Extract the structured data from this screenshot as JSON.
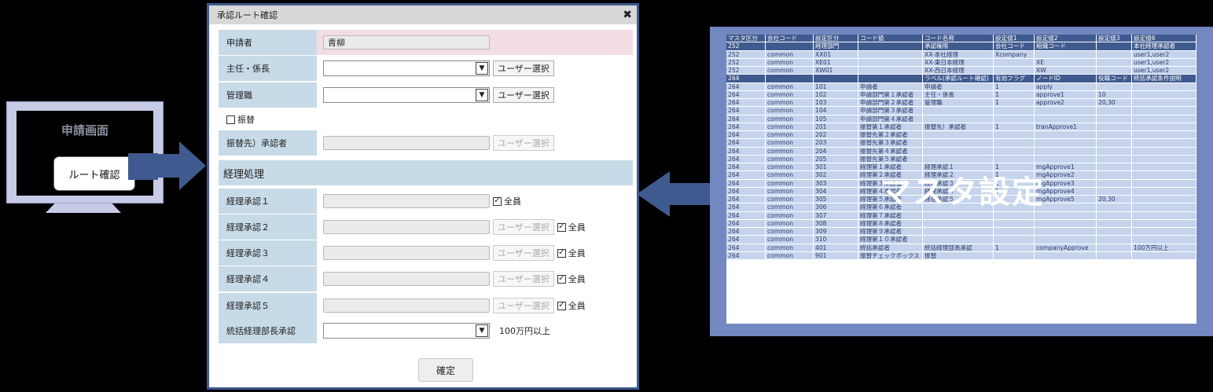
{
  "monitor": {
    "title": "申請画面",
    "button": "ルート確認"
  },
  "dialog": {
    "title": "承認ルート確認",
    "close": "✖",
    "applicant": {
      "label": "申請者",
      "value": "青柳"
    },
    "rows": [
      {
        "label": "主任・係長",
        "btn": "ユーザー選択"
      },
      {
        "label": "管理職",
        "btn": "ユーザー選択"
      }
    ],
    "transfer_checkbox": "振替",
    "transfer_approver": {
      "label": "振替先）承認者",
      "btn": "ユーザー選択"
    },
    "section": "経理処理",
    "accounting": [
      {
        "label": "経理承認１",
        "btn": "",
        "check": "全員"
      },
      {
        "label": "経理承認２",
        "btn": "ユーザー選択",
        "check": "全員"
      },
      {
        "label": "経理承認３",
        "btn": "ユーザー選択",
        "check": "全員"
      },
      {
        "label": "経理承認４",
        "btn": "ユーザー選択",
        "check": "全員"
      },
      {
        "label": "経理承認５",
        "btn": "ユーザー選択",
        "check": "全員"
      }
    ],
    "director": {
      "label": "統括経理部長承認",
      "note": "100万円以上"
    },
    "confirm": "確定"
  },
  "master": {
    "label": "マスタ設定",
    "header1": [
      "マスタ区分",
      "会社コード",
      "設定区分",
      "コード値",
      "コード名称",
      "設定値1",
      "設定値2",
      "設定値3",
      "設定値6"
    ],
    "header2": [
      "252",
      "",
      "経理部門",
      "",
      "承認権限",
      "会社コード",
      "組織コード",
      "",
      "本社経理承認者"
    ],
    "group1": [
      [
        "252",
        "common",
        "XX01",
        "",
        "XX-本社経理",
        "Xcompany",
        "",
        "",
        "user1,user2"
      ],
      [
        "252",
        "common",
        "XE01",
        "",
        "XX-東日本経理",
        "",
        "XE",
        "",
        "user1,user2"
      ],
      [
        "252",
        "common",
        "XW01",
        "",
        "XX-西日本経理",
        "",
        "XW",
        "",
        "user1,user2"
      ]
    ],
    "header3": [
      "264",
      "",
      "",
      "",
      "ラベル(承認ルート確認)",
      "有効フラグ",
      "ノードID",
      "役職コード",
      "統括承認条件説明"
    ],
    "group2": [
      [
        "264",
        "common",
        "101",
        "申請者",
        "申請者",
        "1",
        "apply",
        "",
        ""
      ],
      [
        "264",
        "common",
        "102",
        "申請部門第１承認者",
        "主任・係長",
        "1",
        "approve1",
        "10",
        ""
      ],
      [
        "264",
        "common",
        "103",
        "申請部門第２承認者",
        "管理職",
        "1",
        "approve2",
        "20,30",
        ""
      ],
      [
        "264",
        "common",
        "104",
        "申請部門第３承認者",
        "",
        "",
        "",
        "",
        ""
      ],
      [
        "264",
        "common",
        "105",
        "申請部門第４承認者",
        "",
        "",
        "",
        "",
        ""
      ],
      [
        "264",
        "common",
        "201",
        "振替第１承認者",
        "振替先）承認者",
        "1",
        "tranApprove1",
        "",
        ""
      ],
      [
        "264",
        "common",
        "202",
        "振替先第２承認者",
        "",
        "",
        "",
        "",
        ""
      ],
      [
        "264",
        "common",
        "203",
        "振替先第３承認者",
        "",
        "",
        "",
        "",
        ""
      ],
      [
        "264",
        "common",
        "204",
        "振替先第４承認者",
        "",
        "",
        "",
        "",
        ""
      ],
      [
        "264",
        "common",
        "205",
        "振替先第５承認者",
        "",
        "",
        "",
        "",
        ""
      ],
      [
        "264",
        "common",
        "301",
        "経理第１承認者",
        "経理承認１",
        "1",
        "mgApprove1",
        "",
        ""
      ],
      [
        "264",
        "common",
        "302",
        "経理第２承認者",
        "経理承認２",
        "1",
        "mgApprove2",
        "",
        ""
      ],
      [
        "264",
        "common",
        "303",
        "経理第３承認者",
        "経理承認３",
        "1",
        "mgApprove3",
        "",
        ""
      ],
      [
        "264",
        "common",
        "304",
        "経理第４承認者",
        "経理承認４",
        "1",
        "mgApprove4",
        "",
        ""
      ],
      [
        "264",
        "common",
        "305",
        "経理第５承認者",
        "経理承認５",
        "1",
        "mgApprove5",
        "20,30",
        ""
      ],
      [
        "264",
        "common",
        "306",
        "経理第６承認者",
        "",
        "",
        "",
        "",
        ""
      ],
      [
        "264",
        "common",
        "307",
        "経理第７承認者",
        "",
        "",
        "",
        "",
        ""
      ],
      [
        "264",
        "common",
        "308",
        "経理第８承認者",
        "",
        "",
        "",
        "",
        ""
      ],
      [
        "264",
        "common",
        "309",
        "経理第９承認者",
        "",
        "",
        "",
        "",
        ""
      ],
      [
        "264",
        "common",
        "310",
        "経理第１０承認者",
        "",
        "",
        "",
        "",
        ""
      ],
      [
        "264",
        "common",
        "401",
        "統括承認者",
        "統括経理部長承認",
        "1",
        "companyApprove",
        "",
        "100万円以上"
      ],
      [
        "264",
        "common",
        "901",
        "振替チェックボックス",
        "振替",
        "",
        "",
        "",
        ""
      ]
    ]
  },
  "colors": {
    "accent": "#3f5a8e",
    "label_bg": "#c7dae7",
    "table_row": "#c5d3ec"
  }
}
